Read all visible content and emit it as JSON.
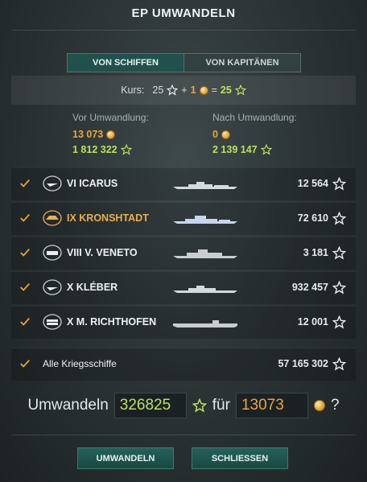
{
  "dialog": {
    "title": "EP UMWANDELN"
  },
  "tabs": [
    {
      "label": "VON SCHIFFEN",
      "active": true
    },
    {
      "label": "VON KAPITÄNEN",
      "active": false
    }
  ],
  "rate": {
    "prefix": "Kurs:",
    "left": "25",
    "plus": "+",
    "gold": "1",
    "equals": "=",
    "right": "25"
  },
  "before": {
    "label": "Vor Umwandlung:",
    "gold": "13 073",
    "ep": "1 812 322"
  },
  "after": {
    "label": "Nach Umwandlung:",
    "gold": "0",
    "ep": "2 139 147"
  },
  "ships": [
    {
      "name": "VI ICARUS",
      "value": "12 564",
      "highlight": false,
      "class_icon": "destroyer-icon"
    },
    {
      "name": "IX KRONSHTADT",
      "value": "72 610",
      "highlight": true,
      "class_icon": "cruiser-icon"
    },
    {
      "name": "VIII V. VENETO",
      "value": "3 181",
      "highlight": false,
      "class_icon": "battleship-icon"
    },
    {
      "name": "X KLÉBER",
      "value": "932 457",
      "highlight": false,
      "class_icon": "destroyer-icon"
    },
    {
      "name": "X M. RICHTHOFEN",
      "value": "12 001",
      "highlight": false,
      "class_icon": "carrier-icon"
    }
  ],
  "all": {
    "label": "Alle Kriegsschiffe",
    "value": "57 165 302"
  },
  "convert": {
    "prefix": "Umwandeln",
    "ep_value": "326825",
    "for": "für",
    "gold_value": "13073",
    "suffix": "?"
  },
  "buttons": {
    "convert": "UMWANDELN",
    "close": "SCHLIESSEN"
  },
  "colors": {
    "gold": "#e8a73a",
    "green": "#b9e25c",
    "accent": "#20514c",
    "highlight": "#e6b04d"
  }
}
